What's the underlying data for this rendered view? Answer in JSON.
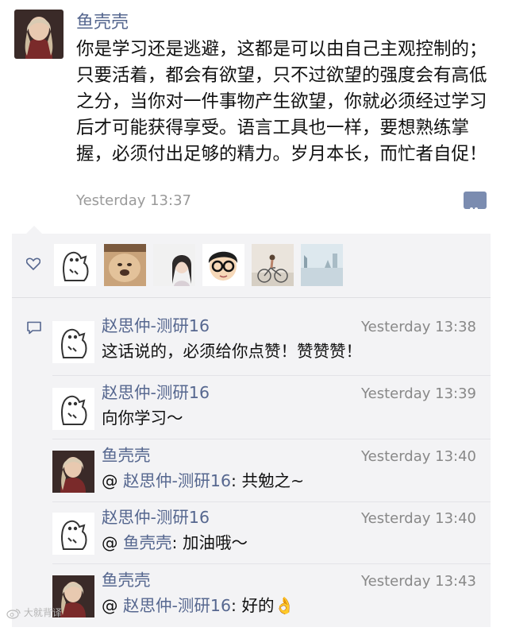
{
  "post": {
    "author": "鱼壳壳",
    "text": "你是学习还是逃避，这都是可以由自己主观控制的；只要活着，都会有欲望，只不过欲望的强度会有高低之分，当你对一件事物产生欲望，你就必须经过学习后才可能获得享受。语言工具也一样，要想熟练掌握，必须付出足够的精力。岁月本长，而忙者自促！",
    "time": "Yesterday 13:37"
  },
  "likes": {
    "avatars": [
      "cartoon-fish-avatar",
      "dog-photo-avatar",
      "girl-photo-avatar",
      "glasses-boy-avatar",
      "bicycle-photo-avatar",
      "landscape-photo-avatar"
    ]
  },
  "comments": [
    {
      "author": "赵思仲-测研16",
      "time": "Yesterday 13:38",
      "text": "这话说的，必须给你点赞！赞赞赞！",
      "mention": "",
      "avatar": "cartoon-fish-avatar"
    },
    {
      "author": "赵思仲-测研16",
      "time": "Yesterday 13:39",
      "text": "向你学习～",
      "mention": "",
      "avatar": "cartoon-fish-avatar"
    },
    {
      "author": "鱼壳壳",
      "time": "Yesterday 13:40",
      "prefix": "@ ",
      "mention": "赵思仲-测研16",
      "text": ": 共勉之~",
      "avatar": "girl-avatar"
    },
    {
      "author": "赵思仲-测研16",
      "time": "Yesterday 13:40",
      "prefix": "@ ",
      "mention": "鱼壳壳",
      "text": ": 加油哦～",
      "avatar": "cartoon-fish-avatar"
    },
    {
      "author": "鱼壳壳",
      "time": "Yesterday 13:43",
      "prefix": "@ ",
      "mention": "赵思仲-测研16",
      "text": ": 好的",
      "emoji": "👌",
      "avatar": "girl-avatar"
    }
  ],
  "watermark": {
    "text": "大就背译"
  },
  "colors": {
    "name_link": "#56678f",
    "panel_bg": "#f3f3f5",
    "time_gray": "#9a9a9a"
  }
}
